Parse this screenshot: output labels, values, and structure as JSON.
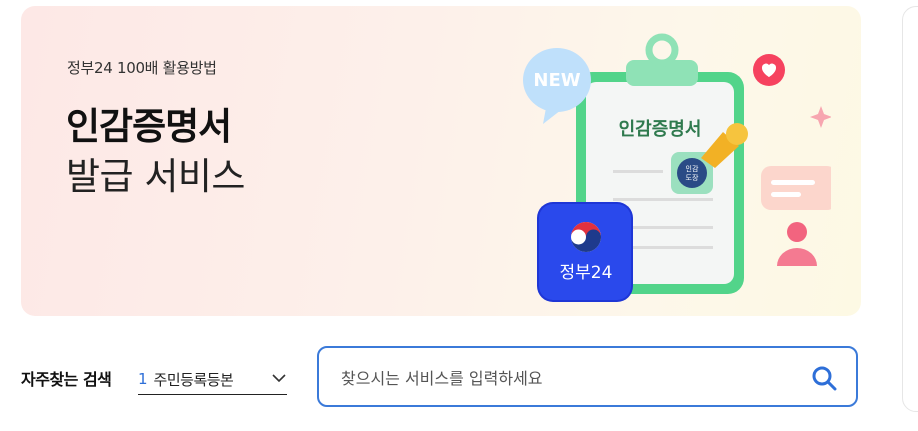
{
  "banner": {
    "eyebrow": "정부24 100배 활용방법",
    "title_line1": "인감증명서",
    "title_line2": "발급 서비스",
    "illustration": {
      "bubble_text": "NEW",
      "clipboard_title": "인감증명서",
      "seal_text": "인감 도장",
      "app_tile_text": "정부24"
    }
  },
  "quick_search": {
    "label": "자주찾는 검색",
    "selected_number": "1",
    "selected_text": "주민등록등본"
  },
  "search": {
    "placeholder": "찾으시는 서비스를 입력하세요"
  },
  "colors": {
    "accent": "#3b7ad9",
    "banner_bg": "#fde8e6"
  }
}
